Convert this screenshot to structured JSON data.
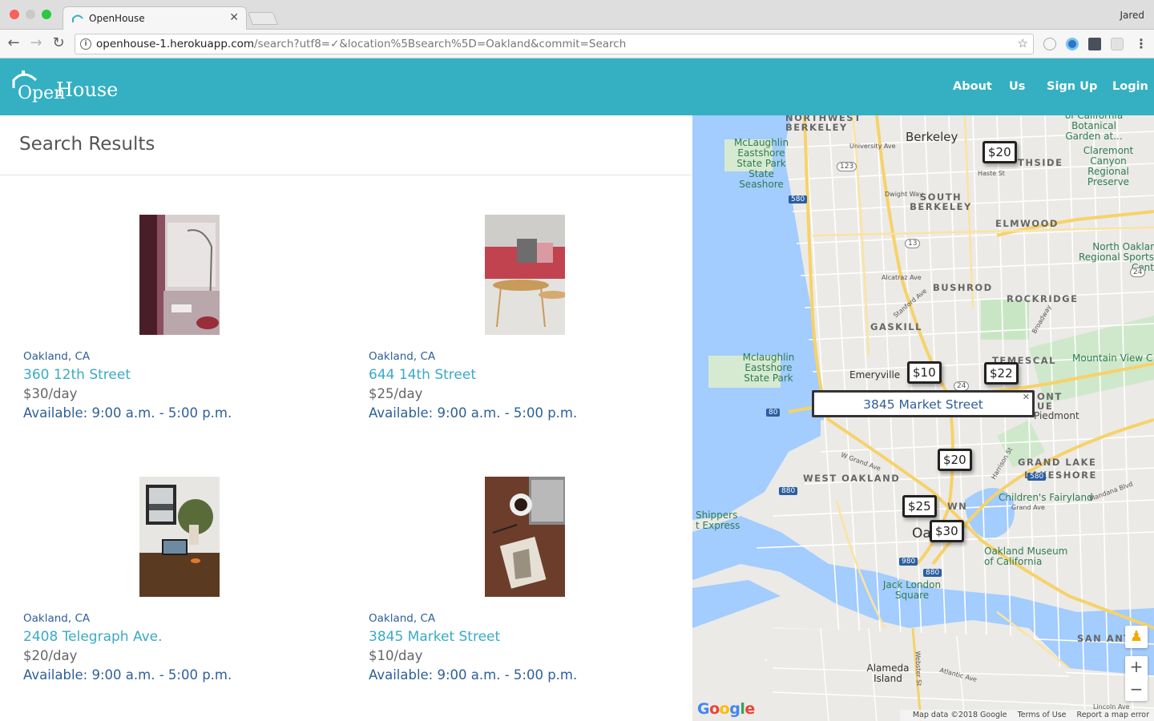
{
  "browser": {
    "tab_title": "OpenHouse",
    "profile_name": "Jared",
    "url_host": "openhouse-1.herokuapp.com",
    "url_path": "/search?utf8=✓&location%5Bsearch%5D=Oakland&commit=Search"
  },
  "header": {
    "logo_open": "Open",
    "logo_house": "House",
    "nav": {
      "about": "About",
      "us": "Us",
      "signup": "Sign Up",
      "login": "Login"
    }
  },
  "results": {
    "title": "Search Results",
    "listings": [
      {
        "city": "Oakland, CA",
        "street": "360 12th Street",
        "price": "$30/day",
        "availability": "Available: 9:00 a.m. - 5:00 p.m."
      },
      {
        "city": "Oakland, CA",
        "street": "644 14th Street",
        "price": "$25/day",
        "availability": "Available: 9:00 a.m. - 5:00 p.m."
      },
      {
        "city": "Oakland, CA",
        "street": "2408 Telegraph Ave.",
        "price": "$20/day",
        "availability": "Available: 9:00 a.m. - 5:00 p.m."
      },
      {
        "city": "Oakland, CA",
        "street": "3845 Market Street",
        "price": "$10/day",
        "availability": "Available: 9:00 a.m. - 5:00 p.m."
      }
    ]
  },
  "map": {
    "pins": [
      "$20",
      "$10",
      "$22",
      "$20",
      "$25",
      "$30"
    ],
    "info_window": "3845 Market Street",
    "zoom_in": "+",
    "zoom_out": "−",
    "google": "Google",
    "attribution": {
      "data": "Map data ©2018 Google",
      "terms": "Terms of Use",
      "report": "Report a map error"
    },
    "labels": {
      "north_berkeley": "NORTHWEST BERKELEY",
      "berkeley": "Berkeley",
      "thside": "THSIDE",
      "botanical": "of California Botanical Garden at...",
      "mclaughlin1": "McLaughlin Eastshore State Park State Seashore",
      "claremont": "Claremont Canyon Regional Preserve",
      "south_berkeley": "SOUTH BERKELEY",
      "elmwood": "ELMWOOD",
      "north_oakland": "North Oaklar Regional Sports Cent",
      "bushrod": "BUSHROD",
      "rockridge": "ROCKRIDGE",
      "gaskill": "GASKILL",
      "mountain_view": "Mountain View C",
      "mclaughlin2": "Mclaughlin Eastshore State Park",
      "emeryville": "Emeryville",
      "temescal": "TEMESCAL",
      "piedmont": "Piedmont",
      "west_oakland": "WEST OAKLAND",
      "grand_lake": "GRAND LAKE",
      "lakeshore": "LAKESHORE",
      "childrens": "Children's Fairyland",
      "shippers": "Shippers t Express",
      "oakland_museum": "Oakland Museum of California",
      "jack_london": "Jack London Square",
      "san_antonio": "SAN ANTO",
      "alameda": "Alameda Island",
      "oakland_center": "Oa",
      "town": "WN",
      "nt": "ONT UE",
      "university_ave": "University Ave",
      "haste_st": "Haste St",
      "dwight_way": "Dwight Way",
      "alcatraz": "Alcatraz Ave",
      "stanford": "Stanford Ave",
      "broadway": "Broadway",
      "grand_ave": "Grand Ave",
      "w_grand": "W Grand Ave",
      "lincoln": "Lincoln Ave",
      "webster": "Webster St",
      "atlantic": "Atlantic Ave",
      "harrison": "Harrison St",
      "mandana": "Mandana Blvd",
      "r123": "123",
      "r580a": "580",
      "r13": "13",
      "r24a": "24",
      "r24b": "24",
      "r80": "80",
      "r880a": "880",
      "r880b": "880",
      "r980": "980",
      "r580b": "580"
    }
  }
}
